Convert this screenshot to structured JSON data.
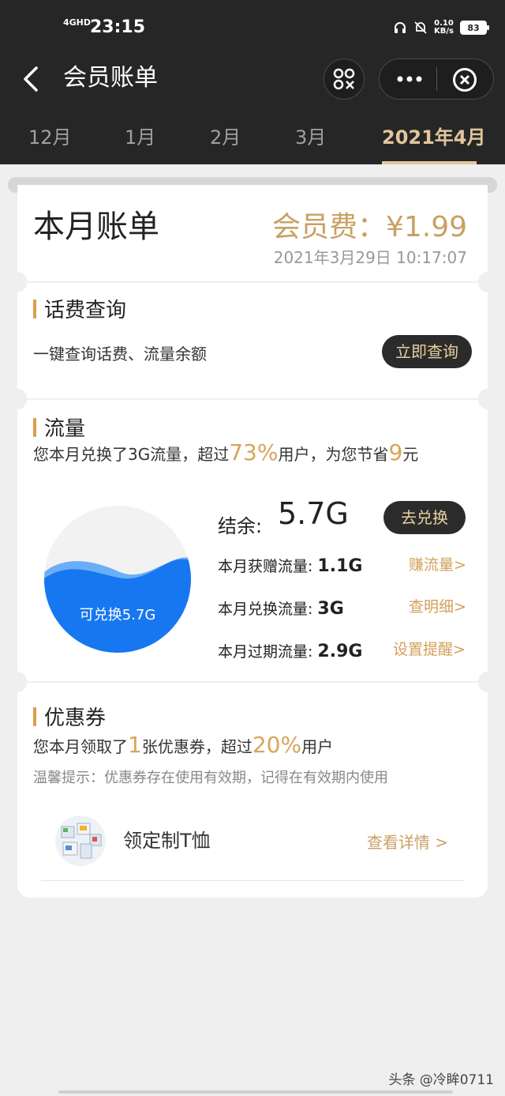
{
  "status": {
    "network": "4GHD",
    "time": "23:15",
    "speed_value": "0.10",
    "speed_unit": "KB/s",
    "battery": "83"
  },
  "nav": {
    "title": "会员账单",
    "icons": [
      "back-icon",
      "scan-icon",
      "more-icon",
      "close-icon"
    ]
  },
  "tabs": [
    {
      "label": "12月",
      "active": false
    },
    {
      "label": "1月",
      "active": false
    },
    {
      "label": "2月",
      "active": false
    },
    {
      "label": "3月",
      "active": false
    },
    {
      "label": "2021年4月",
      "active": true
    }
  ],
  "bill": {
    "title": "本月账单",
    "fee": "会员费：¥1.99",
    "date": "2021年3月29日 10:17:07"
  },
  "phone_fee": {
    "heading": "话费查询",
    "desc": "一键查询话费、流量余额",
    "button": "立即查询"
  },
  "data_flow": {
    "heading": "流量",
    "summary_prefix": "您本月兑换了3G流量，超过",
    "summary_percent": "73%",
    "summary_mid": "用户，为您节省",
    "summary_save": "9",
    "summary_suffix": "元",
    "balance_label": "结余:",
    "balance_value": "5.7G",
    "redeem_button": "去兑换",
    "wave_label": "可兑换5.7G",
    "rows": [
      {
        "label": "本月获赠流量:",
        "value": "1.1G",
        "link": "赚流量>"
      },
      {
        "label": "本月兑换流量:",
        "value": "3G",
        "link": "查明细>"
      },
      {
        "label": "本月过期流量:",
        "value": "2.9G",
        "link": "设置提醒>"
      }
    ]
  },
  "coupon": {
    "heading": "优惠券",
    "summary_prefix": "您本月领取了",
    "summary_count": "1",
    "summary_mid": "张优惠券，超过",
    "summary_percent": "20%",
    "summary_suffix": "用户",
    "tip": "温馨提示：优惠券存在使用有效期，记得在有效期内使用",
    "item_name": "领定制T恤",
    "item_link": "查看详情 >"
  },
  "watermark": "头条 @冷眸0711",
  "colors": {
    "dark_bg": "#262626",
    "gold": "#c9a064",
    "accent_bar": "#d9a04b",
    "wave_blue": "#1677f0"
  }
}
